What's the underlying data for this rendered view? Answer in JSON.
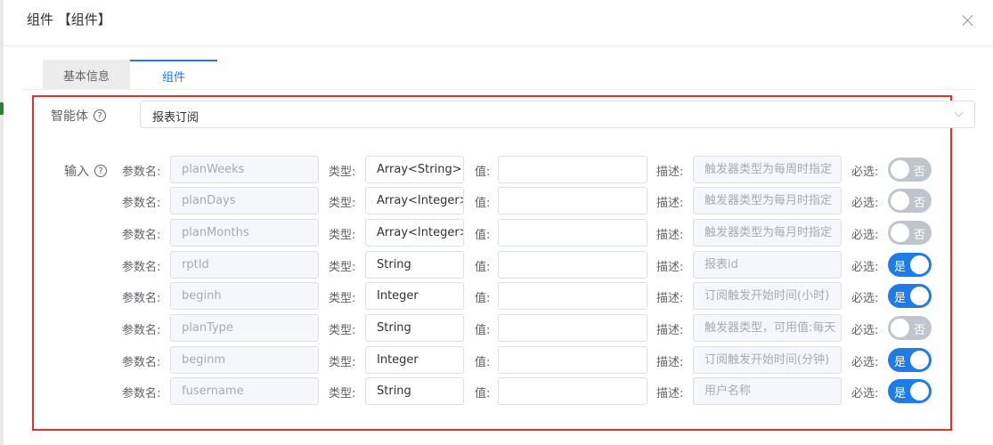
{
  "dialog": {
    "title": "组件 【组件】"
  },
  "tabs": [
    {
      "label": "基本信息",
      "active": false
    },
    {
      "label": "组件",
      "active": true
    }
  ],
  "agent": {
    "label": "智能体",
    "value": "报表订阅"
  },
  "inputs": {
    "label": "输入",
    "param_name_label": "参数名:",
    "type_label": "类型:",
    "value_label": "值:",
    "desc_label": "描述:",
    "required_label": "必选:",
    "rows": [
      {
        "name": "planWeeks",
        "type": "Array<String>",
        "value": "",
        "desc": "触发器类型为每周时指定",
        "required": false,
        "switch_text": "否"
      },
      {
        "name": "planDays",
        "type": "Array<Integer>",
        "value": "",
        "desc": "触发器类型为每月时指定",
        "required": false,
        "switch_text": "否"
      },
      {
        "name": "planMonths",
        "type": "Array<Integer>",
        "value": "",
        "desc": "触发器类型为每月时指定",
        "required": false,
        "switch_text": "否"
      },
      {
        "name": "rptId",
        "type": "String",
        "value": "",
        "desc": "报表id",
        "required": true,
        "switch_text": "是"
      },
      {
        "name": "beginh",
        "type": "Integer",
        "value": "",
        "desc": "订阅触发开始时间(小时)",
        "required": true,
        "switch_text": "是"
      },
      {
        "name": "planType",
        "type": "String",
        "value": "",
        "desc": "触发器类型，可用值:每天",
        "required": false,
        "switch_text": "否"
      },
      {
        "name": "beginm",
        "type": "Integer",
        "value": "",
        "desc": "订阅触发开始时间(分钟)",
        "required": true,
        "switch_text": "是"
      },
      {
        "name": "fusername",
        "type": "String",
        "value": "",
        "desc": "用户名称",
        "required": true,
        "switch_text": "是"
      }
    ]
  },
  "icons": {
    "help": "help-circle-icon",
    "close": "close-icon",
    "dropdown": "chevron-down-icon"
  },
  "colors": {
    "accent": "#1e7be8",
    "highlight_border": "#e8302a",
    "switch_off": "#c0c4cc"
  }
}
